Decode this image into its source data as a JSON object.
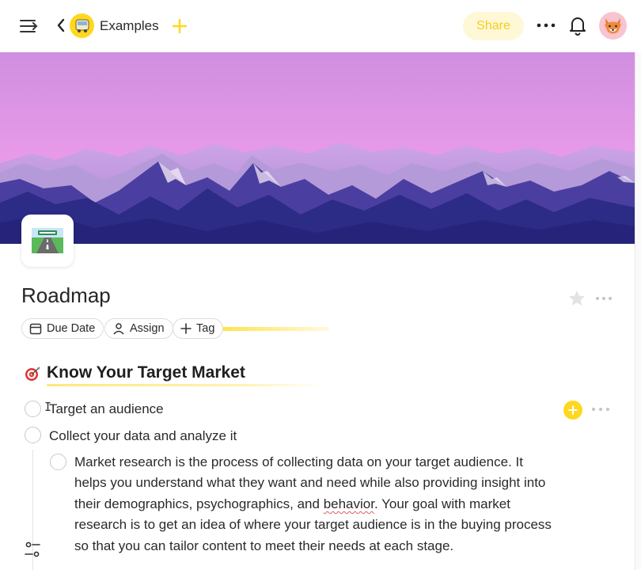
{
  "topbar": {
    "breadcrumb": "Examples",
    "share_label": "Share"
  },
  "page": {
    "title": "Roadmap",
    "chips": {
      "due_date": "Due Date",
      "assign": "Assign",
      "tag": "Tag"
    }
  },
  "section": {
    "heading": "Know Your Target Market",
    "tasks": [
      {
        "text": "Target an audience",
        "checked": false
      },
      {
        "text": "Collect your data and analyze it",
        "checked": false
      }
    ],
    "subtask": {
      "before": "Market research is the process of collecting data on your target audience. It helps you understand what they want and need while also providing insight into their demographics, psychographics, and ",
      "misspelled": "behavior",
      "after": ". Your goal with market research is to get an idea of where your target audience is in the buying process so that you can tailor content to meet their needs at each stage."
    }
  },
  "colors": {
    "accent": "#ffd71e",
    "share_bg": "#fff8d6",
    "cover_sky_top": "#cf8fe0",
    "cover_sky_bottom": "#f3a6ef",
    "mountain": "#2c2b86"
  },
  "icons": {
    "menu": "sidebar-toggle-icon",
    "back": "chevron-left-icon",
    "workspace": "bus-icon",
    "add": "plus-icon",
    "more": "ellipsis-icon",
    "notifications": "bell-icon",
    "avatar": "fox-avatar-icon",
    "page_icon": "road-icon",
    "favorite": "star-icon",
    "heading": "target-icon",
    "settings": "sliders-icon"
  }
}
